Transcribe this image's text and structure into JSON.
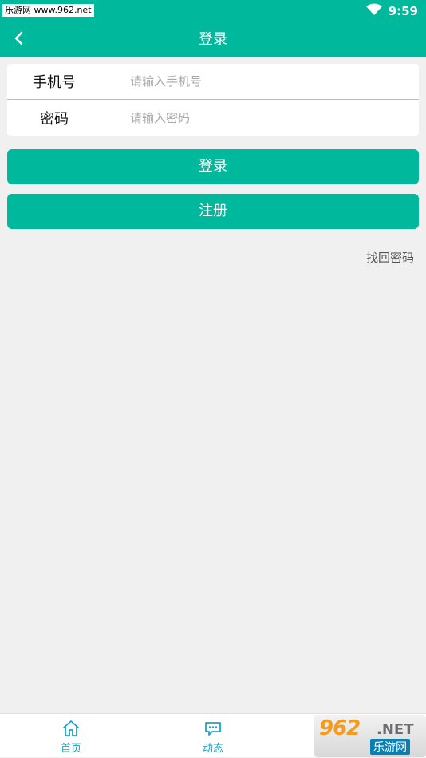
{
  "status_bar": {
    "watermark": "乐游网 www.962.net",
    "time": "9:59",
    "wifi_icon": "wifi-icon"
  },
  "navbar": {
    "title": "登录",
    "back_icon": "chevron-left-icon"
  },
  "form": {
    "phone_label": "手机号",
    "phone_placeholder": "请输入手机号",
    "password_label": "密码",
    "password_placeholder": "请输入密码"
  },
  "buttons": {
    "login": "登录",
    "register": "注册",
    "forgot_password": "找回密码"
  },
  "tabbar": {
    "items": [
      {
        "label": "首页",
        "icon": "home-icon"
      },
      {
        "label": "动态",
        "icon": "chat-bubble-icon"
      }
    ]
  },
  "watermark_logo": {
    "number": "962",
    "suffix": ".NET",
    "name": "乐游网"
  },
  "colors": {
    "primary": "#00b99d",
    "background": "#f0f0f0",
    "tab_active": "#1aa3c8"
  }
}
